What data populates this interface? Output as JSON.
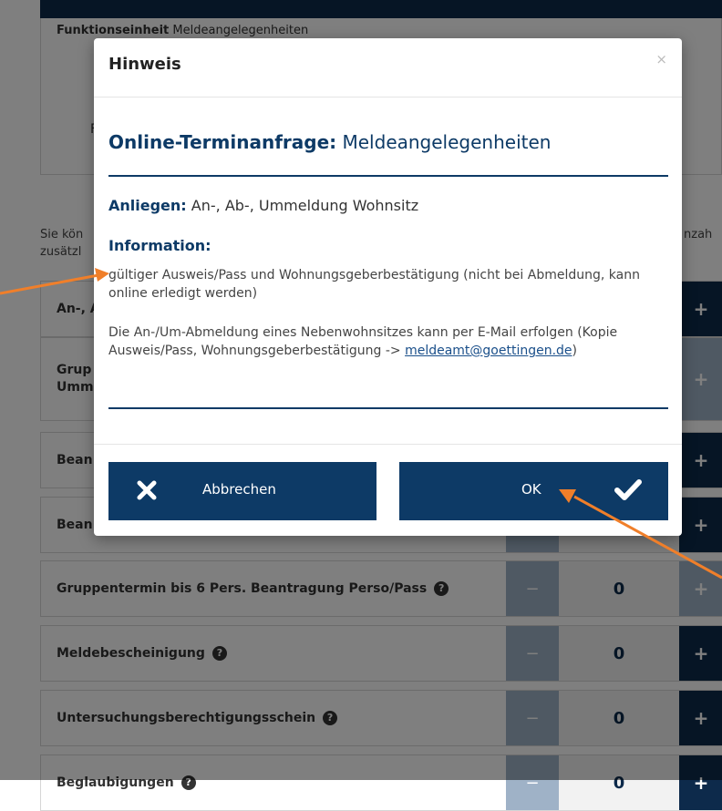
{
  "background": {
    "fe_label": "Funktionseinheit",
    "fe_value": "Meldeangelegenheiten",
    "fe_letter": "F",
    "intro_left_1": "Sie kön",
    "intro_left_2": "zusätzl",
    "intro_right": "nzah",
    "rows": [
      {
        "label": "An-, A",
        "count": "",
        "plus_disabled": false
      },
      {
        "label_1": "Grup",
        "label_2": "Umm",
        "count": "",
        "plus_disabled": true
      },
      {
        "label": "Bean",
        "count": "",
        "plus_disabled": false
      },
      {
        "label": "Bean",
        "count": "",
        "plus_disabled": false
      },
      {
        "label": "Gruppentermin bis 6 Pers. Beantragung Perso/Pass",
        "count": "0",
        "plus_disabled": true
      },
      {
        "label": "Meldebescheinigung",
        "count": "0",
        "plus_disabled": false
      },
      {
        "label": "Untersuchungsberechtigungsschein",
        "count": "0",
        "plus_disabled": false
      },
      {
        "label": "Beglaubigungen",
        "count": "0",
        "plus_disabled": false
      }
    ],
    "minus_symbol": "−",
    "plus_symbol": "+",
    "help_symbol": "?"
  },
  "modal": {
    "title": "Hinweis",
    "close": "×",
    "heading_bold": "Online-Terminanfrage:",
    "heading_rest": "Meldeangelegenheiten",
    "anliegen_label": "Anliegen:",
    "anliegen_value": "An-, Ab-, Ummeldung Wohnsitz",
    "information_label": "Information:",
    "info_1": "gültiger Ausweis/Pass und Wohnungsgeberbestätigung (nicht bei Abmeldung, kann online erledigt werden)",
    "info_2_text": "Die An-/Um-Abmeldung eines Nebenwohnsitzes kann per E-Mail erfolgen (Kopie Ausweis/Pass, Wohnungsgeberbestätigung ->",
    "info_2_email": "meldeamt@goettingen.de",
    "info_2_end": ")",
    "cancel_label": "Abbrechen",
    "ok_label": "OK"
  },
  "colors": {
    "primary": "#0d3a66",
    "disabled": "#9fb2c7",
    "annotation_arrow": "#f07f2a"
  }
}
